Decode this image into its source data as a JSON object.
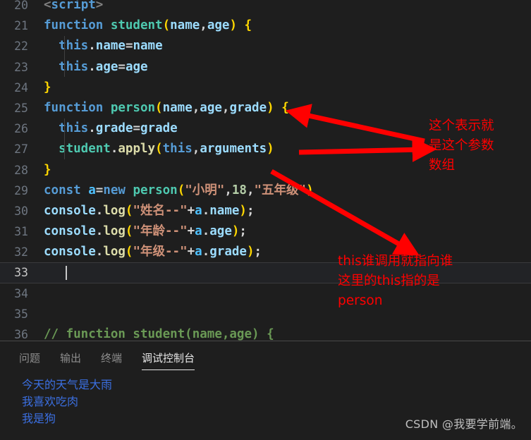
{
  "editor": {
    "language": "javascript",
    "active_line": 33,
    "lines": [
      {
        "num": "20",
        "tokens": [
          {
            "t": "<",
            "c": "t-angle"
          },
          {
            "t": "script",
            "c": "t-tag"
          },
          {
            "t": ">",
            "c": "t-angle"
          }
        ]
      },
      {
        "num": "21",
        "tokens": [
          {
            "t": "function ",
            "c": "t-kw"
          },
          {
            "t": "student",
            "c": "t-fn"
          },
          {
            "t": "(",
            "c": "t-paren1"
          },
          {
            "t": "name",
            "c": "t-var"
          },
          {
            "t": ",",
            "c": "t-punc"
          },
          {
            "t": "age",
            "c": "t-var"
          },
          {
            "t": ")",
            "c": "t-paren1"
          },
          {
            "t": " ",
            "c": "t-plain"
          },
          {
            "t": "{",
            "c": "t-paren1"
          }
        ]
      },
      {
        "num": "22",
        "tokens": [
          {
            "t": "  ",
            "c": "t-plain"
          },
          {
            "t": "this",
            "c": "t-this"
          },
          {
            "t": ".",
            "c": "t-punc"
          },
          {
            "t": "name",
            "c": "t-var"
          },
          {
            "t": "=",
            "c": "t-plain"
          },
          {
            "t": "name",
            "c": "t-var"
          }
        ]
      },
      {
        "num": "23",
        "tokens": [
          {
            "t": "  ",
            "c": "t-plain"
          },
          {
            "t": "this",
            "c": "t-this"
          },
          {
            "t": ".",
            "c": "t-punc"
          },
          {
            "t": "age",
            "c": "t-var"
          },
          {
            "t": "=",
            "c": "t-plain"
          },
          {
            "t": "age",
            "c": "t-var"
          }
        ]
      },
      {
        "num": "24",
        "tokens": [
          {
            "t": "}",
            "c": "t-paren1"
          }
        ]
      },
      {
        "num": "25",
        "tokens": [
          {
            "t": "function ",
            "c": "t-kw"
          },
          {
            "t": "person",
            "c": "t-fn"
          },
          {
            "t": "(",
            "c": "t-paren1"
          },
          {
            "t": "name",
            "c": "t-var"
          },
          {
            "t": ",",
            "c": "t-punc"
          },
          {
            "t": "age",
            "c": "t-var"
          },
          {
            "t": ",",
            "c": "t-punc"
          },
          {
            "t": "grade",
            "c": "t-var"
          },
          {
            "t": ")",
            "c": "t-paren1"
          },
          {
            "t": " ",
            "c": "t-plain"
          },
          {
            "t": "{",
            "c": "t-paren1"
          }
        ]
      },
      {
        "num": "26",
        "tokens": [
          {
            "t": "  ",
            "c": "t-plain"
          },
          {
            "t": "this",
            "c": "t-this"
          },
          {
            "t": ".",
            "c": "t-punc"
          },
          {
            "t": "grade",
            "c": "t-var"
          },
          {
            "t": "=",
            "c": "t-plain"
          },
          {
            "t": "grade",
            "c": "t-var"
          }
        ]
      },
      {
        "num": "27",
        "tokens": [
          {
            "t": "  ",
            "c": "t-plain"
          },
          {
            "t": "student",
            "c": "t-fn"
          },
          {
            "t": ".",
            "c": "t-punc"
          },
          {
            "t": "apply",
            "c": "t-fn2"
          },
          {
            "t": "(",
            "c": "t-paren1"
          },
          {
            "t": "this",
            "c": "t-this"
          },
          {
            "t": ",",
            "c": "t-punc"
          },
          {
            "t": "arguments",
            "c": "t-var"
          },
          {
            "t": ")",
            "c": "t-paren1"
          }
        ]
      },
      {
        "num": "28",
        "tokens": [
          {
            "t": "}",
            "c": "t-paren1"
          }
        ]
      },
      {
        "num": "29",
        "tokens": [
          {
            "t": "const ",
            "c": "t-kw"
          },
          {
            "t": "a",
            "c": "t-obj"
          },
          {
            "t": "=",
            "c": "t-plain"
          },
          {
            "t": "new ",
            "c": "t-kw"
          },
          {
            "t": "person",
            "c": "t-fn"
          },
          {
            "t": "(",
            "c": "t-paren1"
          },
          {
            "t": "\"小明\"",
            "c": "t-str"
          },
          {
            "t": ",",
            "c": "t-punc"
          },
          {
            "t": "18",
            "c": "t-num"
          },
          {
            "t": ",",
            "c": "t-punc"
          },
          {
            "t": "\"五年级\"",
            "c": "t-str"
          },
          {
            "t": ")",
            "c": "t-paren1"
          }
        ]
      },
      {
        "num": "30",
        "tokens": [
          {
            "t": "console",
            "c": "t-var"
          },
          {
            "t": ".",
            "c": "t-punc"
          },
          {
            "t": "log",
            "c": "t-fn2"
          },
          {
            "t": "(",
            "c": "t-paren1"
          },
          {
            "t": "\"姓名--\"",
            "c": "t-str"
          },
          {
            "t": "+",
            "c": "t-plain"
          },
          {
            "t": "a",
            "c": "t-obj"
          },
          {
            "t": ".",
            "c": "t-punc"
          },
          {
            "t": "name",
            "c": "t-var"
          },
          {
            "t": ")",
            "c": "t-paren1"
          },
          {
            "t": ";",
            "c": "t-punc"
          }
        ]
      },
      {
        "num": "31",
        "tokens": [
          {
            "t": "console",
            "c": "t-var"
          },
          {
            "t": ".",
            "c": "t-punc"
          },
          {
            "t": "log",
            "c": "t-fn2"
          },
          {
            "t": "(",
            "c": "t-paren1"
          },
          {
            "t": "\"年龄--\"",
            "c": "t-str"
          },
          {
            "t": "+",
            "c": "t-plain"
          },
          {
            "t": "a",
            "c": "t-obj"
          },
          {
            "t": ".",
            "c": "t-punc"
          },
          {
            "t": "age",
            "c": "t-var"
          },
          {
            "t": ")",
            "c": "t-paren1"
          },
          {
            "t": ";",
            "c": "t-punc"
          }
        ]
      },
      {
        "num": "32",
        "tokens": [
          {
            "t": "console",
            "c": "t-var"
          },
          {
            "t": ".",
            "c": "t-punc"
          },
          {
            "t": "log",
            "c": "t-fn2"
          },
          {
            "t": "(",
            "c": "t-paren1"
          },
          {
            "t": "\"年级--\"",
            "c": "t-str"
          },
          {
            "t": "+",
            "c": "t-plain"
          },
          {
            "t": "a",
            "c": "t-obj"
          },
          {
            "t": ".",
            "c": "t-punc"
          },
          {
            "t": "grade",
            "c": "t-var"
          },
          {
            "t": ")",
            "c": "t-paren1"
          },
          {
            "t": ";",
            "c": "t-punc"
          }
        ]
      },
      {
        "num": "33",
        "tokens": []
      },
      {
        "num": "34",
        "tokens": []
      },
      {
        "num": "35",
        "tokens": []
      },
      {
        "num": "36",
        "tokens": [
          {
            "t": "// function student(name,age) {",
            "c": "t-com"
          }
        ]
      }
    ]
  },
  "annotations": {
    "color": "#ff0000",
    "arguments_note": "这个表示就\n是这个参数\n数组",
    "this_note": "this谁调用就指向谁\n这里的this指的是\nperson"
  },
  "panel": {
    "tabs": [
      {
        "label": "问题",
        "active": false
      },
      {
        "label": "输出",
        "active": false
      },
      {
        "label": "终端",
        "active": false
      },
      {
        "label": "调试控制台",
        "active": true
      }
    ],
    "console_lines": [
      "今天的天气是大雨",
      "我喜欢吃肉",
      "我是狗"
    ],
    "console_color": "#3b6fe0"
  },
  "watermark": "CSDN @我要学前端。"
}
